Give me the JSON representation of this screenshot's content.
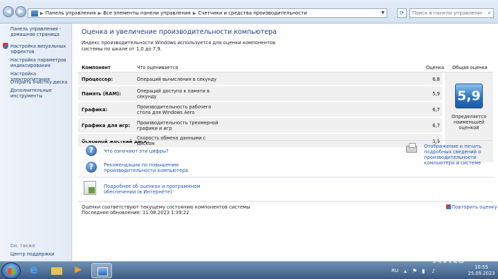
{
  "address_bar": {
    "breadcrumbs": [
      "Панель управления",
      "Все элементы панели управления",
      "Счетчики и средства производительности"
    ],
    "search_placeholder": "Поиск в панели управления"
  },
  "sidebar": {
    "home_link": "Панель управления - домашняя страница",
    "items": [
      "Настройка визуальных эффектов",
      "Настройка параметров индексирования",
      "Настройка электропитания",
      "Открыть очистку диска",
      "Дополнительные инструменты"
    ],
    "see_also_label": "См. также",
    "support_link": "Центр поддержки"
  },
  "main": {
    "title": "Оценка и увеличение производительности компьютера",
    "intro": "Индекс производительности Windows используется для оценки компонентов системы по шкале от 1,0 до 7,9.",
    "table": {
      "headers": {
        "component": "Компонент",
        "rated": "Что оценивается",
        "score": "Оценка",
        "base": "Общая оценка"
      },
      "rows": [
        {
          "component": "Процессор:",
          "rated": "Операций вычисления в секунду",
          "score": "6,8"
        },
        {
          "component": "Память (RAM):",
          "rated": "Операций доступа к памяти в секунду",
          "score": "5,9"
        },
        {
          "component": "Графика:",
          "rated": "Производительность рабочего стола для Windows Aero",
          "score": "6,7"
        },
        {
          "component": "Графика для игр:",
          "rated": "Производительность трехмерной графики и игр",
          "score": "6,7"
        },
        {
          "component": "Основной жесткий диск:",
          "rated": "Скорость обмена данными с диском",
          "score": "5,9"
        }
      ],
      "base_score": "5,9",
      "base_note": "Определяется наименьшей оценкой"
    },
    "links": {
      "what_numbers": "Что означают эти цифры?",
      "recommendations": "Рекомендации по повышению производительности компьютера.",
      "print": "Отображение и печать подробных сведений о производительности компьютера и системе",
      "details_online": "Подробнее об оценках и программном обеспечении (в Интернете)"
    },
    "status": "Оценки соответствуют текущему состоянию компонентов системы",
    "last_update": "Последнее обновление: 11.08.2023 1:39:22",
    "rerun": "Повторить оценку"
  },
  "taskbar": {
    "language": "RU",
    "time": "10:55",
    "date": "25.09.2023"
  },
  "watermark": "Avito"
}
